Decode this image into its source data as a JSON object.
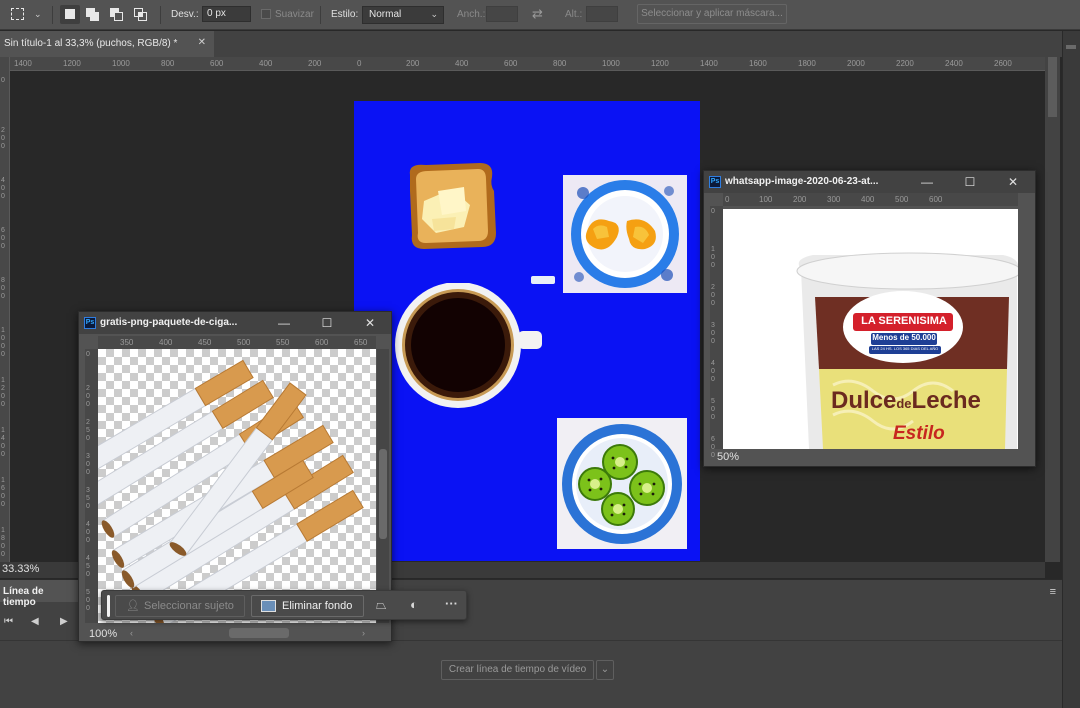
{
  "options_bar": {
    "feather_label": "Desv.:",
    "feather_value": "0 px",
    "antialias_label": "Suavizar",
    "style_label": "Estilo:",
    "style_value": "Normal",
    "width_label": "Anch.:",
    "height_label": "Alt.:",
    "select_mask_label": "Seleccionar y aplicar máscara..."
  },
  "document": {
    "tab_title": "Sin título-1 al 33,3% (puchos, RGB/8) *",
    "zoom": "33.33%",
    "ruler_h": [
      "1400",
      "1200",
      "1000",
      "800",
      "600",
      "400",
      "200",
      "0",
      "200",
      "400",
      "600",
      "800",
      "1000",
      "1200",
      "1400",
      "1600",
      "1800",
      "2000",
      "2200",
      "2400",
      "2600"
    ],
    "ruler_v": [
      "0",
      "200",
      "400",
      "600",
      "800",
      "1000",
      "1200",
      "1400",
      "1600",
      "1800"
    ],
    "artboard_color": "#0a12f4"
  },
  "window_cigarettes": {
    "title": "gratis-png-paquete-de-ciga...",
    "zoom": "100%",
    "ruler_h": [
      "350",
      "400",
      "450",
      "500",
      "550",
      "600",
      "650"
    ],
    "ruler_v": [
      "0",
      "200",
      "250",
      "300",
      "350",
      "400",
      "450",
      "500"
    ]
  },
  "window_dulce": {
    "title": "whatsapp-image-2020-06-23-at...",
    "zoom": "50%",
    "ruler_h": [
      "0",
      "100",
      "200",
      "300",
      "400",
      "500",
      "600"
    ],
    "ruler_v": [
      "0",
      "100",
      "200",
      "300",
      "400",
      "500",
      "600"
    ],
    "brand": "LA SERENISIMA",
    "tagline": "Menos de 50.000",
    "subline": "LAS 24 HS. LOS 365 DIAS DEL AÑO",
    "product_a": "Dulce",
    "product_b": "de",
    "product_c": "Leche",
    "variant": "Estilo"
  },
  "task_bar": {
    "select_subject": "Seleccionar sujeto",
    "remove_bg": "Eliminar fondo"
  },
  "timeline": {
    "tab_label": "Línea de tiempo",
    "create_label": "Crear línea de tiempo de vídeo"
  }
}
